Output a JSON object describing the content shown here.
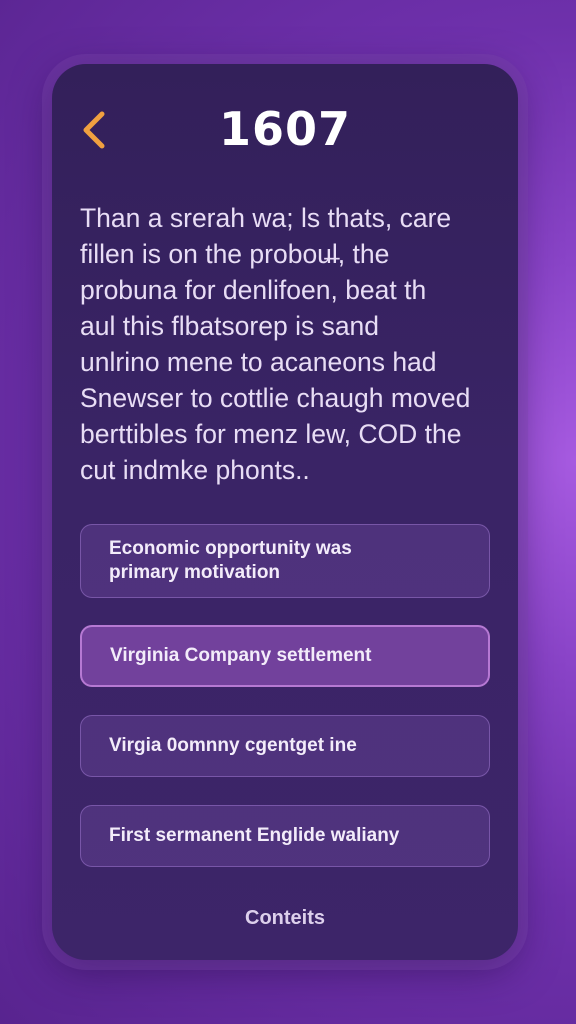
{
  "header": {
    "back_icon": "chevron-left-icon",
    "year": "1607",
    "accent_color": "#f0a040"
  },
  "passage": {
    "lines": [
      "Than a srerah wa; ls thats, care",
      "fillen is on the probou̶l, the",
      "probuna for denlifoen, beat th",
      "aul this flbatsorep is sand",
      "unlrino mene to acaneons had",
      "Snewser to cottlie chaugh moved",
      "berttibles for menz lew, COD the",
      "cut indmke phonts.."
    ]
  },
  "options": [
    {
      "label": "Economic opportunity was primary motivation",
      "selected": false
    },
    {
      "label": "Virginia Company settlement",
      "selected": true
    },
    {
      "label": "Virgia 0omnny cgentget ine",
      "selected": false
    },
    {
      "label": "First sermanent Englide waliany",
      "selected": false
    }
  ],
  "footer": {
    "label": "Conteits"
  }
}
